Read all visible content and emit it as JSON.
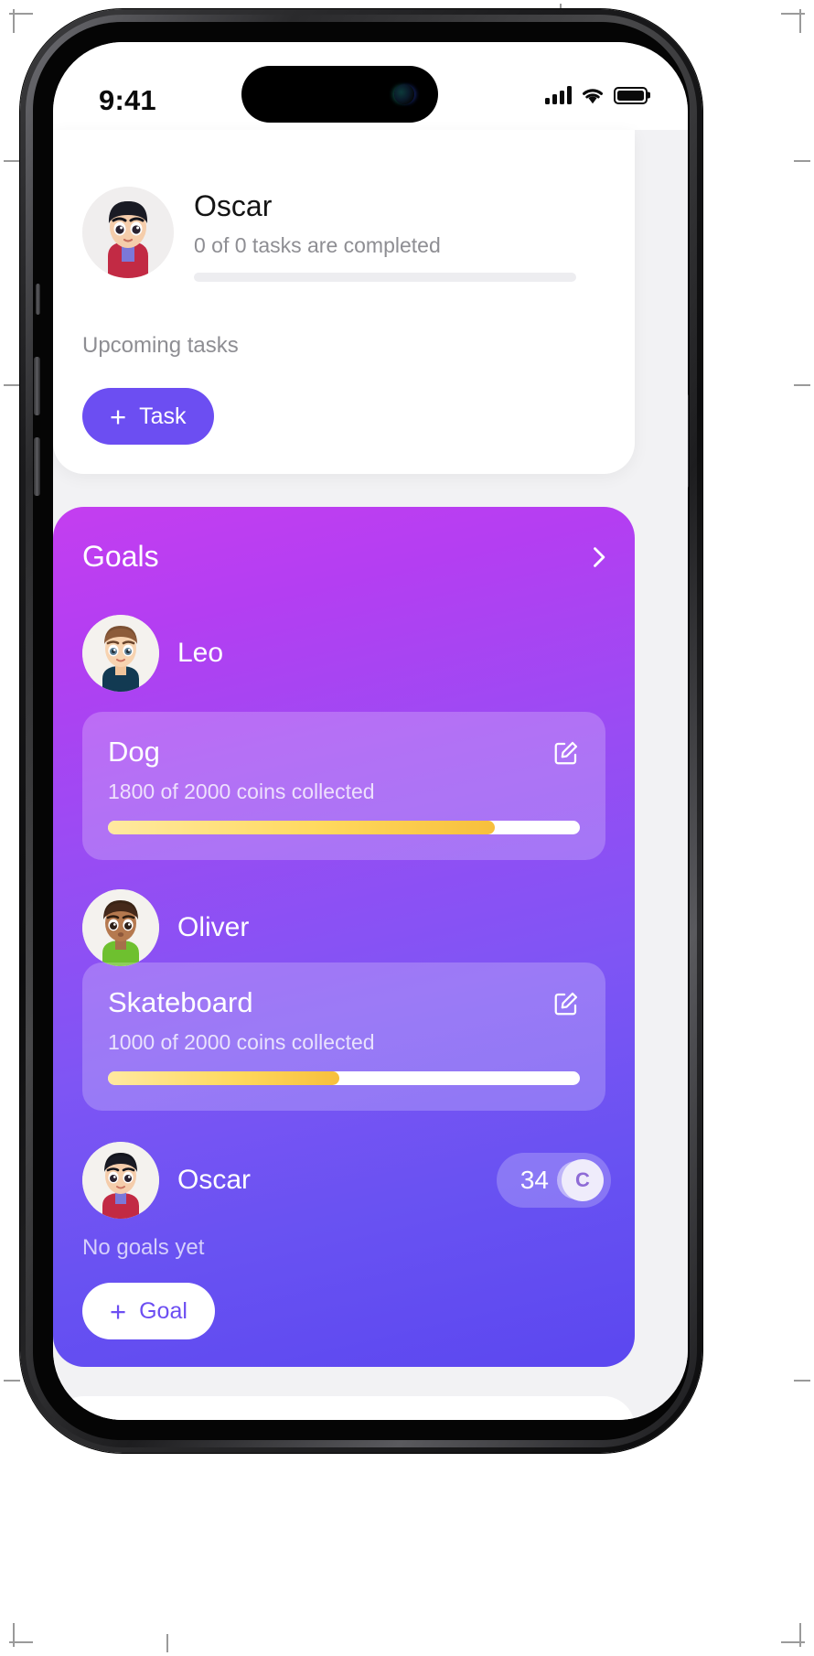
{
  "status_bar": {
    "time": "9:41",
    "icons": [
      "cellular-signal-icon",
      "wifi-icon",
      "battery-icon"
    ]
  },
  "profile_card": {
    "avatar_name": "oscar-avatar",
    "name": "Oscar",
    "tasks_summary": "0 of 0 tasks are completed",
    "progress_percent": 0,
    "section_label": "Upcoming tasks",
    "add_task_button": {
      "plus": "+",
      "label": "Task"
    }
  },
  "goals_card": {
    "title": "Goals",
    "chevron": "chevron-right-icon",
    "children": [
      {
        "name": "Leo",
        "avatar_name": "leo-avatar",
        "goal": {
          "title": "Dog",
          "progress_text": "1800 of 2000 coins collected",
          "current": 1800,
          "target": 2000,
          "percent": 90,
          "edit_icon": "edit-pencil-icon"
        }
      },
      {
        "name": "Oliver",
        "avatar_name": "oliver-avatar",
        "goal": {
          "title": "Skateboard",
          "progress_text": "1000 of 2000 coins collected",
          "current": 1000,
          "target": 2000,
          "percent": 49,
          "edit_icon": "edit-pencil-icon"
        }
      },
      {
        "name": "Oscar",
        "avatar_name": "oscar-avatar",
        "coins": "34",
        "coin_symbol": "C",
        "empty_text": "No goals yet",
        "add_goal_button": {
          "plus": "+",
          "label": "Goal"
        }
      }
    ]
  },
  "colors": {
    "accent_purple": "#6c4ef2",
    "goals_gradient_start": "#c43ef0",
    "goals_gradient_end": "#5b47f0",
    "progress_yellow": "#ffd95e",
    "muted_text": "#8e8e93"
  }
}
